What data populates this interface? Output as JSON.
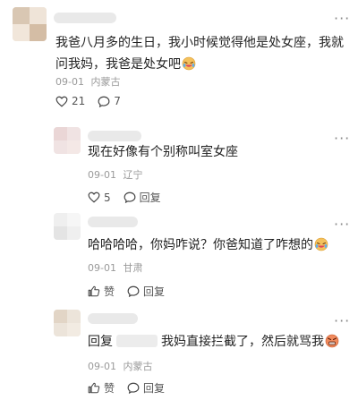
{
  "comments": [
    {
      "text": "我爸八月多的生日，我小时候觉得他是处女座，我就问我妈，我爸是处女吧",
      "date": "09-01",
      "location": "内蒙古",
      "likes": "21",
      "replies": "7",
      "more": "···",
      "emoji": "laughing-crying-emoji"
    }
  ],
  "replies": [
    {
      "text": "现在好像有个别称叫室女座",
      "date": "09-01",
      "location": "辽宁",
      "likes": "5",
      "reply_label": "回复"
    },
    {
      "text": "哈哈哈哈，你妈咋说？你爸知道了咋想的",
      "date": "09-01",
      "location": "甘肃",
      "likes": "赞",
      "reply_label": "回复",
      "emoji": "laughing-crying-emoji"
    },
    {
      "prefix": "回复",
      "text": "我妈直接拦截了，然后就骂我",
      "date": "09-01",
      "location": "内蒙古",
      "likes": "赞",
      "reply_label": "回复",
      "emoji": "angry-emoji"
    }
  ],
  "colors": {
    "meta": "#9a9a9a",
    "text": "#222222",
    "blur": "#e9e9e9"
  }
}
